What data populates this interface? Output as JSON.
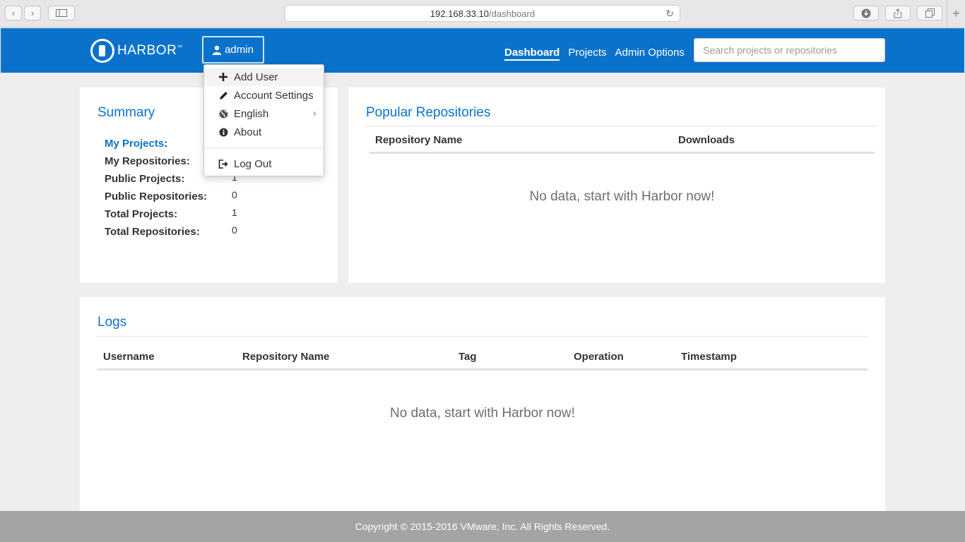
{
  "browser": {
    "url_host": "192.168.33.10",
    "url_path": "/dashboard"
  },
  "navbar": {
    "brand": "HARBOR",
    "brand_mark": "™",
    "user_label": "admin",
    "links": [
      {
        "label": "Dashboard",
        "active": true
      },
      {
        "label": "Projects",
        "active": false
      },
      {
        "label": "Admin Options",
        "active": false
      }
    ],
    "search_placeholder": "Search projects or repositories"
  },
  "user_menu": {
    "items": [
      {
        "label": "Add User",
        "icon": "plus-icon"
      },
      {
        "label": "Account Settings",
        "icon": "pencil-icon"
      },
      {
        "label": "English",
        "icon": "globe-icon"
      },
      {
        "label": "About",
        "icon": "info-icon"
      },
      {
        "label": "Log Out",
        "icon": "logout-icon"
      }
    ]
  },
  "summary": {
    "title": "Summary",
    "rows": [
      {
        "label": "My Projects",
        "suffix": ":",
        "value": ""
      },
      {
        "label": "My Repositories:",
        "value": ""
      },
      {
        "label": "Public Projects:",
        "value": "1"
      },
      {
        "label": "Public Repositories:",
        "value": "0"
      },
      {
        "label": "Total Projects:",
        "value": "1"
      },
      {
        "label": "Total Repositories:",
        "value": "0"
      }
    ]
  },
  "popular": {
    "title": "Popular Repositories",
    "columns": [
      "Repository Name",
      "Downloads"
    ],
    "empty": "No data, start with Harbor now!"
  },
  "logs": {
    "title": "Logs",
    "columns": [
      "Username",
      "Repository Name",
      "Tag",
      "Operation",
      "Timestamp"
    ],
    "empty": "No data, start with Harbor now!"
  },
  "footer": {
    "text": "Copyright © 2015-2016 VMware, Inc. All Rights Reserved."
  }
}
